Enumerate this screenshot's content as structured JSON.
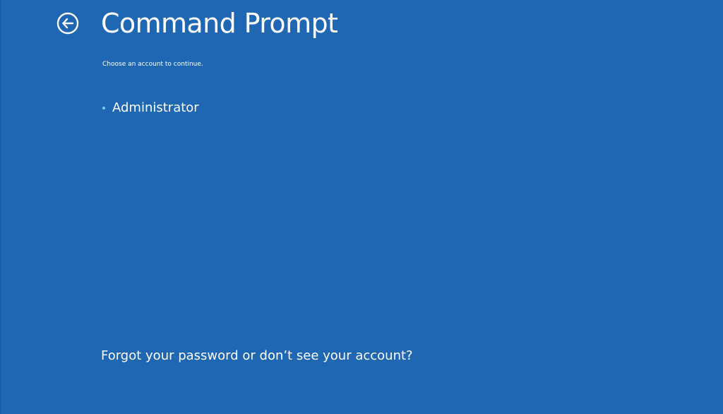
{
  "header": {
    "back_icon": "back-arrow-circle-icon",
    "title": "Command Prompt"
  },
  "main": {
    "subtitle": "Choose an account to continue.",
    "accounts": [
      {
        "name": "Administrator"
      }
    ],
    "forgot_link": "Forgot your password or don’t see your account?"
  },
  "colors": {
    "background": "#1f67b3",
    "text": "#ffffff",
    "bullet_accent": "#6fd0f0"
  }
}
